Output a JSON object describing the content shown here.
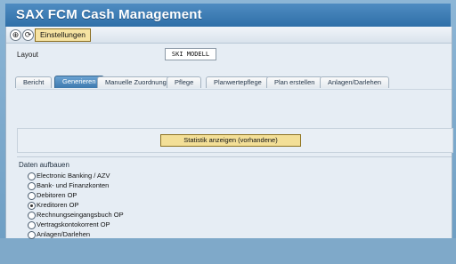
{
  "window": {
    "title": "SAX FCM Cash Management"
  },
  "toolbar": {
    "settings_label": "Einstellungen",
    "execute_icon_name": "execute-icon",
    "help_icon_name": "help-icon"
  },
  "layout": {
    "label": "Layout",
    "value": "SKI MODELL"
  },
  "tabs": [
    {
      "label": "Bericht",
      "active": false
    },
    {
      "label": "Generieren",
      "active": true
    },
    {
      "label": "Manuelle Zuordnung",
      "active": false
    },
    {
      "label": "Pflege",
      "active": false
    },
    {
      "label": "Planwertepflege",
      "active": false
    },
    {
      "label": "Plan erstellen",
      "active": false
    },
    {
      "label": "Anlagen/Darlehen",
      "active": false
    }
  ],
  "statistics": {
    "button_label": "Statistik anzeigen (vorhandene)"
  },
  "data_section": {
    "title": "Daten aufbauen",
    "options": [
      {
        "label": "Electronic Banking / AZV",
        "selected": false
      },
      {
        "label": "Bank- und Finanzkonten",
        "selected": false
      },
      {
        "label": "Debitoren OP",
        "selected": false
      },
      {
        "label": "Kreditoren OP",
        "selected": true
      },
      {
        "label": "Rechnungseingangsbuch OP",
        "selected": false
      },
      {
        "label": "Vertragskontokorrent OP",
        "selected": false
      },
      {
        "label": "Anlagen/Darlehen",
        "selected": false
      }
    ]
  },
  "colors": {
    "title_bar": "#3f7eb8",
    "active_tab": "#4f89bf",
    "button_fill": "#f3df97"
  }
}
